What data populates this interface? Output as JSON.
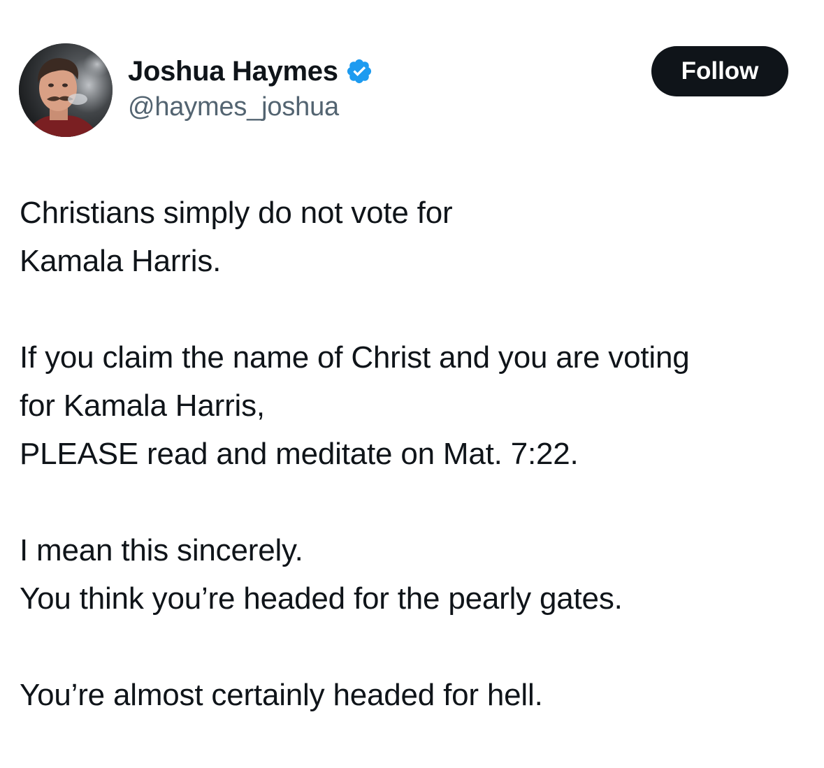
{
  "author": {
    "display_name": "Joshua Haymes",
    "handle": "@haymes_joshua",
    "verified": true,
    "avatar_icon": "profile-photo",
    "verified_icon": "verified-badge-icon",
    "verified_color": "#1d9bf0"
  },
  "follow_button": {
    "label": "Follow",
    "background": "#0f1419"
  },
  "tweet_text": {
    "lines": [
      "Christians simply do not vote for",
      "Kamala Harris.",
      "",
      "If you claim the name of Christ and you are voting",
      "for Kamala Harris,",
      "PLEASE read and meditate on Mat. 7:22.",
      "",
      "I mean this sincerely.",
      "You think you’re headed for the pearly gates.",
      "",
      "You’re almost certainly headed for hell."
    ]
  }
}
